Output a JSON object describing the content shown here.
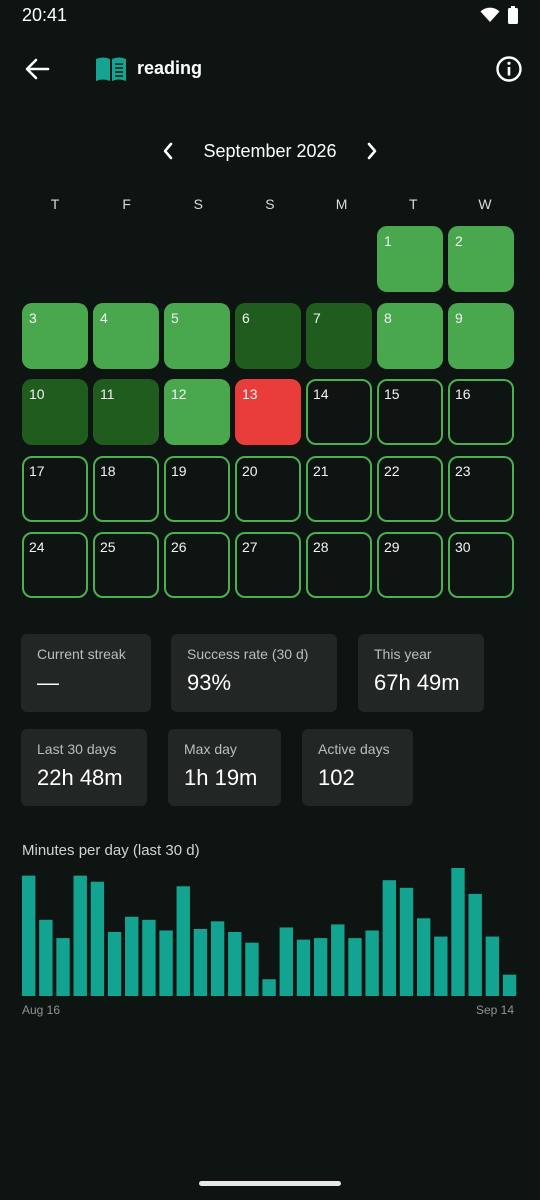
{
  "status_bar": {
    "time": "20:41"
  },
  "header": {
    "title": "reading"
  },
  "calendar": {
    "month_label": "September 2026",
    "weekdays": [
      "T",
      "F",
      "S",
      "S",
      "M",
      "T",
      "W"
    ],
    "start_offset": 5,
    "days": [
      {
        "n": "1",
        "state": "light"
      },
      {
        "n": "2",
        "state": "light"
      },
      {
        "n": "3",
        "state": "light"
      },
      {
        "n": "4",
        "state": "light"
      },
      {
        "n": "5",
        "state": "light"
      },
      {
        "n": "6",
        "state": "dark"
      },
      {
        "n": "7",
        "state": "dark"
      },
      {
        "n": "8",
        "state": "light"
      },
      {
        "n": "9",
        "state": "light"
      },
      {
        "n": "10",
        "state": "dark"
      },
      {
        "n": "11",
        "state": "dark"
      },
      {
        "n": "12",
        "state": "light"
      },
      {
        "n": "13",
        "state": "fail"
      },
      {
        "n": "14",
        "state": "future"
      },
      {
        "n": "15",
        "state": "future"
      },
      {
        "n": "16",
        "state": "future"
      },
      {
        "n": "17",
        "state": "future"
      },
      {
        "n": "18",
        "state": "future"
      },
      {
        "n": "19",
        "state": "future"
      },
      {
        "n": "20",
        "state": "future"
      },
      {
        "n": "21",
        "state": "future"
      },
      {
        "n": "22",
        "state": "future"
      },
      {
        "n": "23",
        "state": "future"
      },
      {
        "n": "24",
        "state": "future"
      },
      {
        "n": "25",
        "state": "future"
      },
      {
        "n": "26",
        "state": "future"
      },
      {
        "n": "27",
        "state": "future"
      },
      {
        "n": "28",
        "state": "future"
      },
      {
        "n": "29",
        "state": "future"
      },
      {
        "n": "30",
        "state": "future"
      }
    ],
    "colors": {
      "light": "#49a84e",
      "dark": "#1f5c1e",
      "fail": "#e83d3a",
      "future_border": "#4caf50"
    }
  },
  "stats": {
    "current_streak": {
      "label": "Current streak",
      "value": "—"
    },
    "success_rate": {
      "label": "Success rate (30 d)",
      "value": "93%"
    },
    "this_year": {
      "label": "This year",
      "value": "67h 49m"
    },
    "last_30_days": {
      "label": "Last 30 days",
      "value": "22h 48m"
    },
    "max_day": {
      "label": "Max day",
      "value": "1h 19m"
    },
    "active_days": {
      "label": "Active days",
      "value": "102"
    }
  },
  "chart_data": {
    "type": "bar",
    "title": "Minutes per day (last 30 d)",
    "x_start_label": "Aug 16",
    "x_end_label": "Sep 14",
    "color": "#13a491",
    "values": [
      79,
      50,
      38,
      79,
      75,
      42,
      52,
      50,
      43,
      72,
      44,
      49,
      42,
      35,
      11,
      45,
      37,
      38,
      47,
      38,
      43,
      76,
      71,
      51,
      39,
      84,
      67,
      39,
      14
    ],
    "ylim": [
      0,
      84
    ]
  }
}
